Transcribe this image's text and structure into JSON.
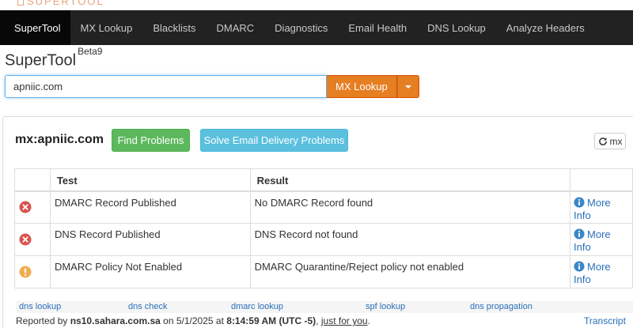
{
  "nav": {
    "items": [
      {
        "label": "SuperTool",
        "active": true
      },
      {
        "label": "MX Lookup"
      },
      {
        "label": "Blacklists"
      },
      {
        "label": "DMARC"
      },
      {
        "label": "Diagnostics"
      },
      {
        "label": "Email Health"
      },
      {
        "label": "DNS Lookup"
      },
      {
        "label": "Analyze Headers"
      }
    ]
  },
  "app": {
    "title": "SuperTool",
    "badge": "Beta9"
  },
  "search": {
    "value": "apniic.com",
    "button_label": "MX Lookup"
  },
  "result": {
    "heading": "mx:apniic.com",
    "find_problems_label": "Find Problems",
    "solve_label": "Solve Email Delivery Problems",
    "refresh_label": "mx"
  },
  "table": {
    "headers": [
      "",
      "Test",
      "Result",
      ""
    ],
    "rows": [
      {
        "status": "error",
        "test": "DMARC Record Published",
        "result": "No DMARC Record found",
        "more": "More Info"
      },
      {
        "status": "error",
        "test": "DNS Record Published",
        "result": "DNS Record not found",
        "more": "More Info"
      },
      {
        "status": "warning",
        "test": "DMARC Policy Not Enabled",
        "result": "DMARC Quarantine/Reject policy not enabled",
        "more": "More Info"
      }
    ]
  },
  "footer": {
    "links": [
      "dns lookup",
      "dns check",
      "dmarc lookup",
      "spf lookup",
      "dns propagation"
    ],
    "reported_prefix": "Reported by",
    "server": "ns10.sahara.com.sa",
    "on": "on",
    "date": "5/1/2025",
    "at": "at",
    "time": "8:14:59 AM (UTC -5)",
    "comma": ",",
    "just_for_you": "just for you",
    "period": ".",
    "transcript": "Transcript"
  },
  "colors": {
    "nav_bg": "#222222",
    "accent_orange": "#e67e22",
    "success_green": "#5cb85c",
    "info_blue": "#5bc0de",
    "error_red": "#d9534f",
    "warning_orange": "#f0ad4e",
    "link_blue": "#2a6fb8"
  },
  "icons": {
    "error": "error-x-circle-icon",
    "warning": "exclamation-circle-icon",
    "info": "info-circle-icon",
    "refresh": "refresh-icon",
    "dropdown": "caret-down-icon"
  }
}
